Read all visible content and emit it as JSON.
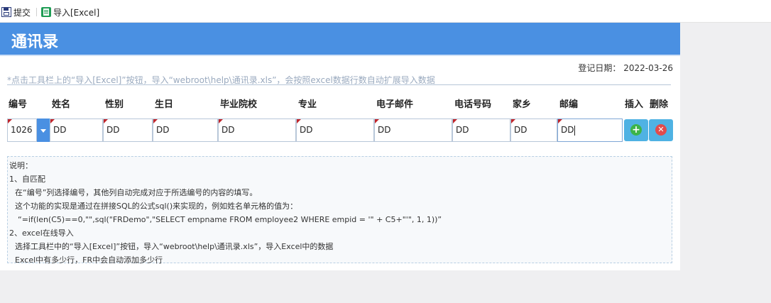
{
  "toolbar": {
    "submit_label": "提交",
    "import_label": "导入[Excel]"
  },
  "panel": {
    "title": "通讯录",
    "register_date_label": "登记日期：",
    "register_date": "2022-03-26",
    "hint": "*点击工具栏上的“导入[Excel]”按钮，导入“webroot\\help\\通讯录.xls”，会按照excel数据行数自动扩展导入数据"
  },
  "table": {
    "headers": [
      "编号",
      "姓名",
      "性别",
      "生日",
      "毕业院校",
      "专业",
      "电子邮件",
      "电话号码",
      "家乡",
      "邮编",
      "插入",
      "删除"
    ],
    "row": [
      "1026",
      "DD",
      "DD",
      "DD",
      "DD",
      "DD",
      "DD",
      "DD",
      "DD",
      "DD"
    ]
  },
  "notes": {
    "lines": [
      "说明：",
      "1、自匹配",
      "在“编号”列选择编号，其他列自动完成对应于所选编号的内容的填写。",
      "这个功能的实现是通过在拼接SQL的公式sql()来实现的，例如姓名单元格的值为：",
      "“=if(len(C5)==0,\"\",sql(\"FRDemo\",\"SELECT empname FROM employee2 WHERE empid = '\" + C5+\"'\", 1, 1))”",
      "2、excel在线导入",
      "选择工具栏中的“导入[Excel]”按钮，导入“webroot\\help\\通讯录.xls”，导入Excel中的数据",
      "Excel中有多少行，FR中会自动添加多少行"
    ]
  },
  "colors": {
    "title_bar": "#4a90e2",
    "action_button": "#4fb2e3",
    "add_icon": "#3cb449",
    "delete_icon": "#e24b4b"
  }
}
